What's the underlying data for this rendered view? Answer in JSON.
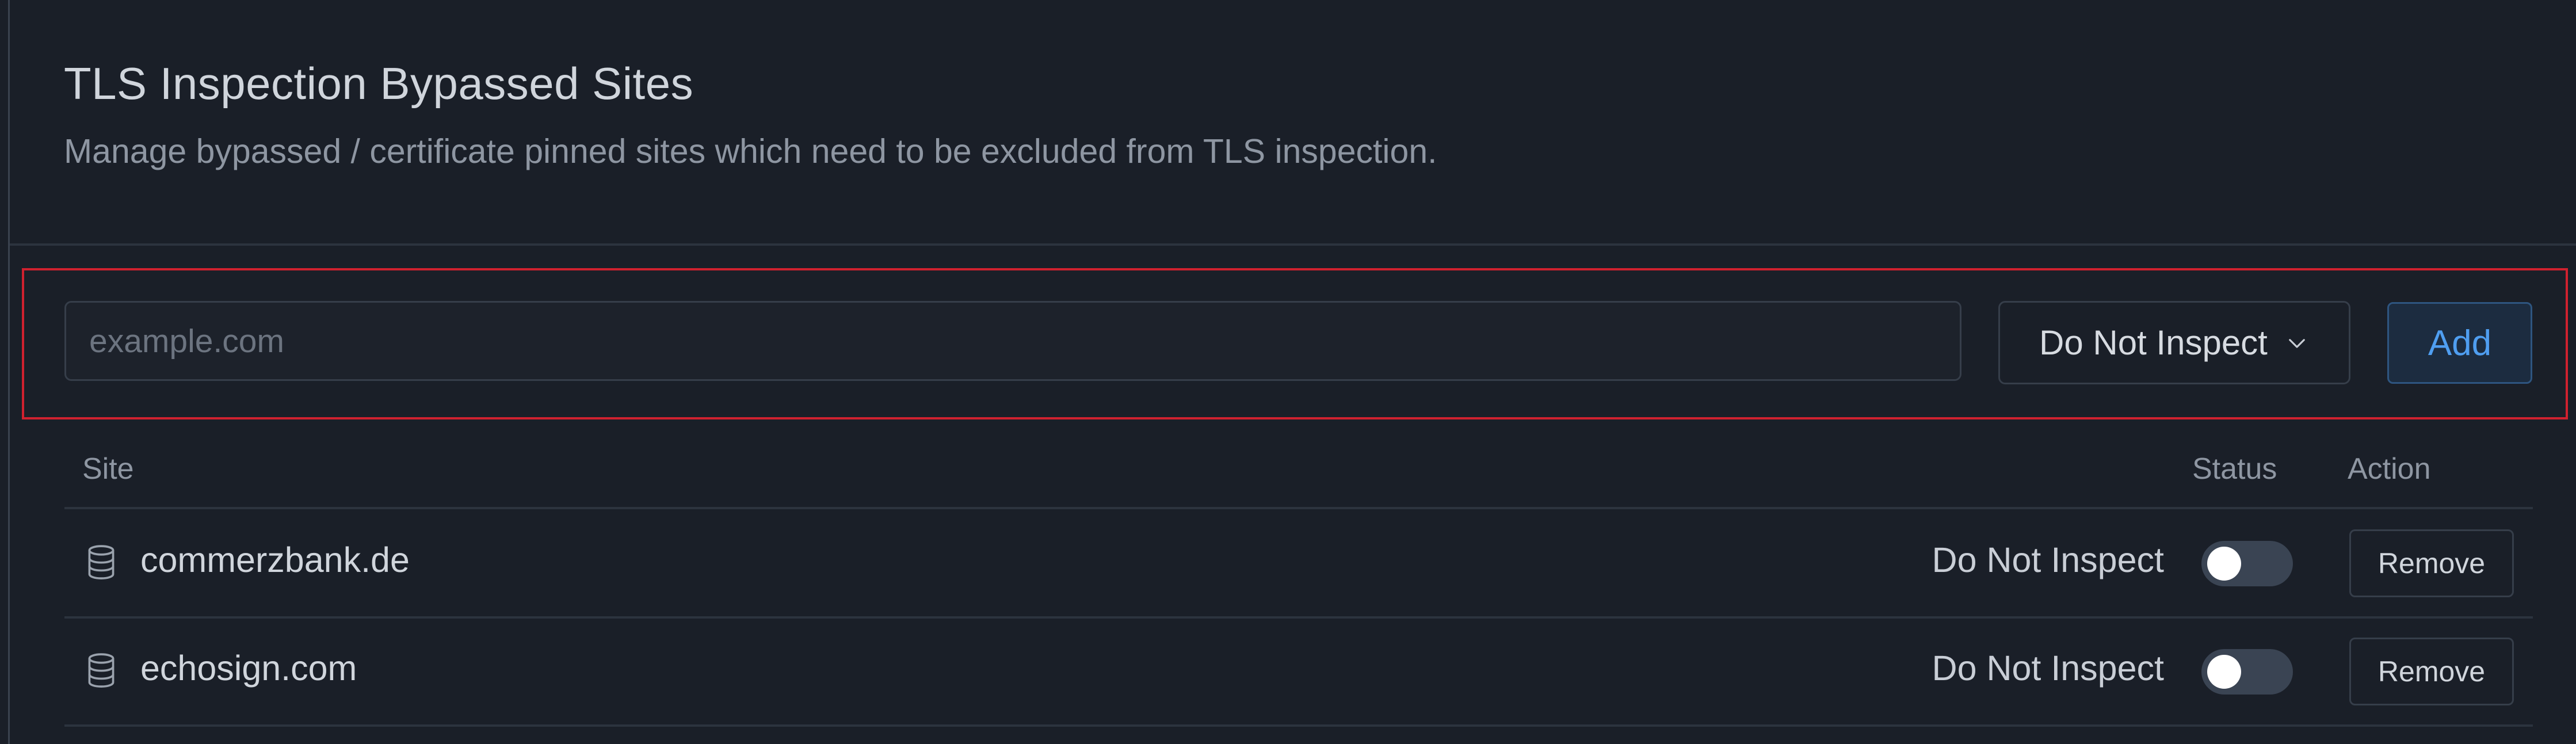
{
  "header": {
    "title": "TLS Inspection Bypassed Sites",
    "subtitle": "Manage bypassed / certificate pinned sites which need to be excluded from TLS inspection."
  },
  "add_form": {
    "site_placeholder": "example.com",
    "site_value": "",
    "mode_selected": "Do Not Inspect",
    "add_label": "Add"
  },
  "table": {
    "columns": [
      "Site",
      "Status",
      "Action"
    ],
    "rows": [
      {
        "site": "commerzbank.de",
        "status": "Do Not Inspect",
        "enabled": false,
        "action": "Remove"
      },
      {
        "site": "echosign.com",
        "status": "Do Not Inspect",
        "enabled": false,
        "action": "Remove"
      }
    ]
  },
  "icons": {
    "row_icon": "database-icon",
    "select_chevron": "chevron-down-icon"
  },
  "colors": {
    "background": "#1a1f28",
    "accent": "#4f9ef0",
    "highlight": "#d0212f",
    "toggle_off": "#3a4453"
  }
}
